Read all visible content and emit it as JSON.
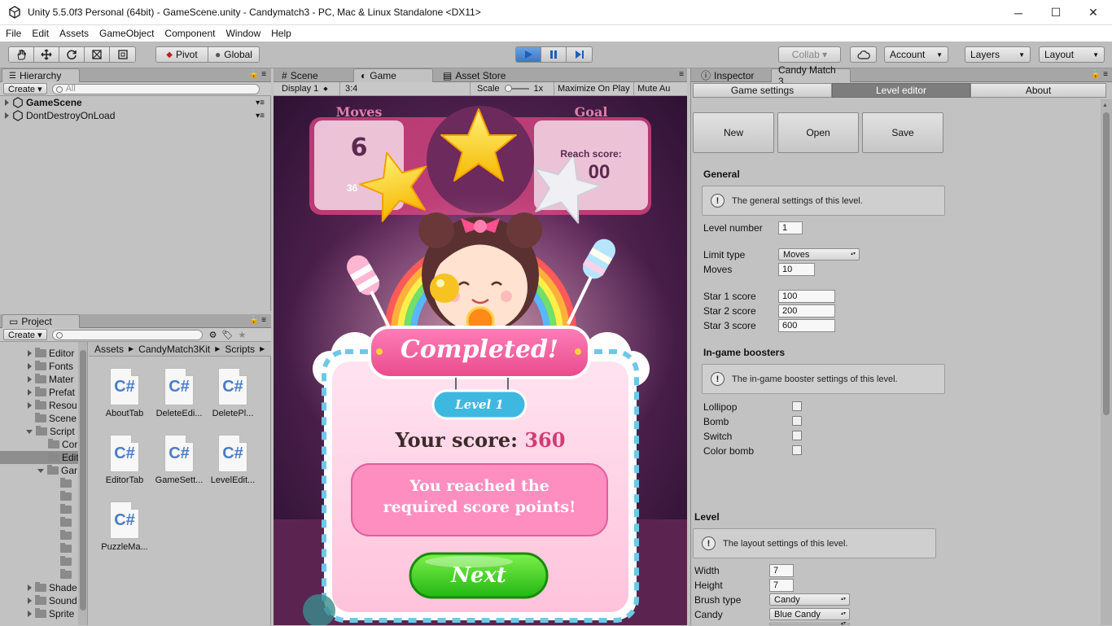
{
  "window": {
    "title": "Unity 5.5.0f3 Personal (64bit) - GameScene.unity - Candymatch3 - PC, Mac & Linux Standalone <DX11>",
    "minimize": "─",
    "maximize": "☐",
    "close": "✕"
  },
  "menu": [
    "File",
    "Edit",
    "Assets",
    "GameObject",
    "Component",
    "Window",
    "Help"
  ],
  "toolbar": {
    "pivot": "Pivot",
    "global": "Global",
    "collab": "Collab ▾",
    "account": "Account",
    "layers": "Layers",
    "layout": "Layout"
  },
  "hierarchy": {
    "tab": "Hierarchy",
    "create": "Create ▾",
    "search_placeholder": "All",
    "items": [
      "GameScene",
      "DontDestroyOnLoad"
    ]
  },
  "project": {
    "tab": "Project",
    "create": "Create ▾",
    "tree": [
      "Editor",
      "Fonts",
      "Mater",
      "Prefat",
      "Resou",
      "Scene",
      "Script",
      "Cor",
      "Editi",
      "Gar",
      "Shade",
      "Sound",
      "Sprite"
    ],
    "breadcrumb": [
      "Assets",
      "CandyMatch3Kit",
      "Scripts"
    ],
    "files": [
      "AboutTab",
      "DeleteEdi...",
      "DeletePl...",
      "EditorTab",
      "GameSett...",
      "LevelEdit...",
      "PuzzleMa..."
    ]
  },
  "gameview": {
    "tabs": [
      "Scene",
      "Game",
      "Asset Store"
    ],
    "display": "Display 1",
    "aspect": "3:4",
    "scale_label": "Scale",
    "scale_value": "1x",
    "maximize": "Maximize On Play",
    "mute": "Mute Au",
    "moves_label": "Moves",
    "moves_value": "6",
    "goal_label": "Goal",
    "goal_text": "Reach score:",
    "goal_value": "00",
    "score_partial": "36",
    "popup_title": "Completed!",
    "level_badge": "Level 1",
    "score_label": "Your score:",
    "score_value": "360",
    "message": "You reached the required score points!",
    "next_button": "Next"
  },
  "inspector": {
    "tabs": [
      "Inspector",
      "Candy Match 3"
    ],
    "subtabs": [
      "Game settings",
      "Level editor",
      "About"
    ],
    "buttons": [
      "New",
      "Open",
      "Save"
    ],
    "general_header": "General",
    "general_info": "The general settings of this level.",
    "level_number_label": "Level number",
    "level_number": "1",
    "limit_type_label": "Limit type",
    "limit_type": "Moves",
    "moves_label": "Moves",
    "moves": "10",
    "star1_label": "Star 1 score",
    "star1": "100",
    "star2_label": "Star 2 score",
    "star2": "200",
    "star3_label": "Star 3 score",
    "star3": "600",
    "boosters_header": "In-game boosters",
    "boosters_info": "The in-game booster settings of this level.",
    "boosters": [
      "Lollipop",
      "Bomb",
      "Switch",
      "Color bomb"
    ],
    "level_header": "Level",
    "level_info": "The layout settings of this level.",
    "width_label": "Width",
    "width": "7",
    "height_label": "Height",
    "height": "7",
    "brush_label": "Brush type",
    "brush": "Candy",
    "candy_label": "Candy",
    "candy": "Blue Candy"
  }
}
